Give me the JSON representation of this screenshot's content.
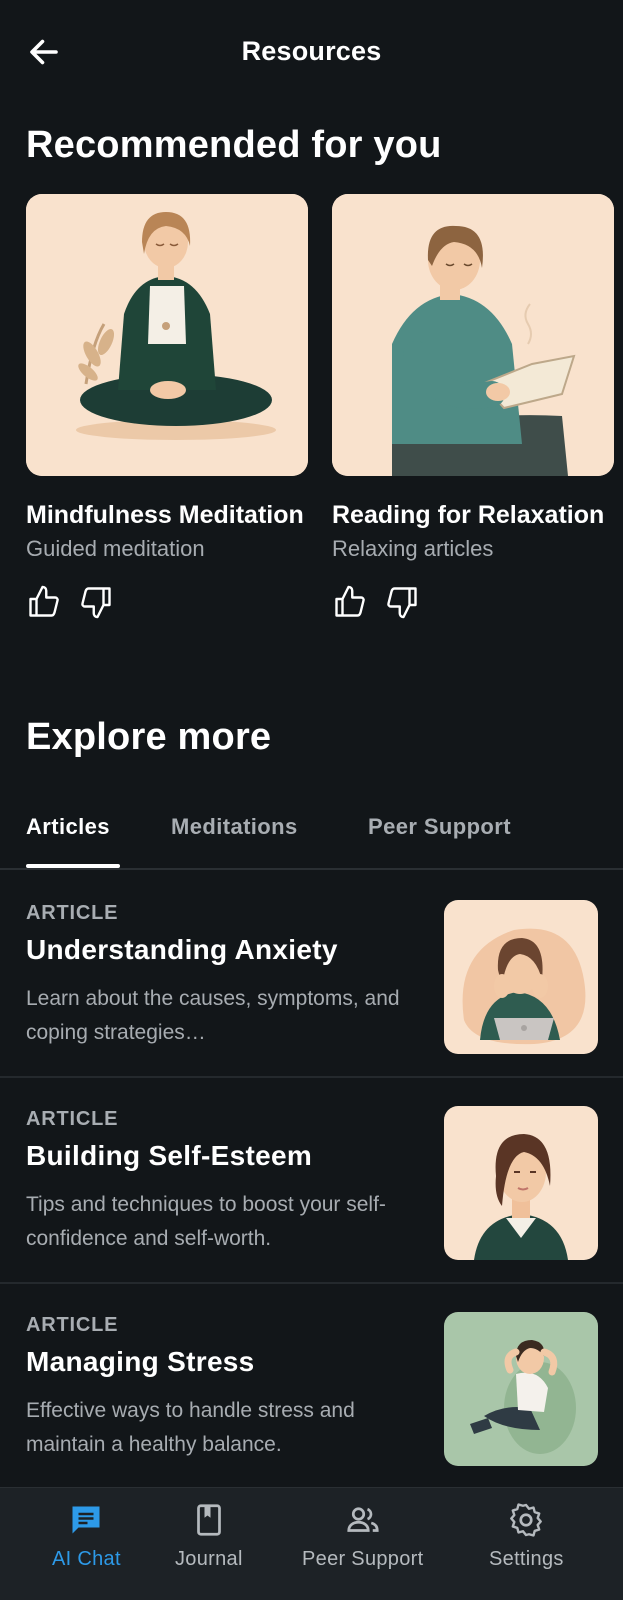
{
  "header": {
    "title": "Resources",
    "back_icon": "arrow-left-icon"
  },
  "recommended": {
    "heading": "Recommended for you",
    "cards": [
      {
        "title": "Mindfulness Meditation",
        "subtitle": "Guided meditation",
        "image": "woman-meditating-illustration"
      },
      {
        "title": "Reading for Relaxation",
        "subtitle": "Relaxing articles",
        "image": "man-reading-book-illustration"
      }
    ]
  },
  "explore": {
    "heading": "Explore more",
    "tabs": [
      {
        "label": "Articles",
        "active": true
      },
      {
        "label": "Meditations",
        "active": false
      },
      {
        "label": "Peer Support",
        "active": false
      }
    ],
    "articles": [
      {
        "tag": "ARTICLE",
        "title": "Understanding Anxiety",
        "description": "Learn about the causes, symptoms, and coping strategies…",
        "image": "anxious-woman-laptop-illustration"
      },
      {
        "tag": "ARTICLE",
        "title": "Building Self-Esteem",
        "description": "Tips and techniques to boost your self-confidence and self-worth.",
        "image": "woman-portrait-illustration"
      },
      {
        "tag": "ARTICLE",
        "title": "Managing Stress",
        "description": "Effective ways to handle stress and maintain a healthy balance.",
        "image": "relaxed-man-illustration"
      }
    ]
  },
  "bottom_nav": {
    "items": [
      {
        "label": "AI Chat",
        "icon": "chat-icon",
        "active": true
      },
      {
        "label": "Journal",
        "icon": "journal-icon",
        "active": false
      },
      {
        "label": "Peer Support",
        "icon": "people-icon",
        "active": false
      },
      {
        "label": "Settings",
        "icon": "gear-icon",
        "active": false
      }
    ]
  },
  "colors": {
    "background": "#121619",
    "accent": "#2d9ae8",
    "muted_text": "#a7acb1",
    "card_bg": "#f9e2cd"
  }
}
